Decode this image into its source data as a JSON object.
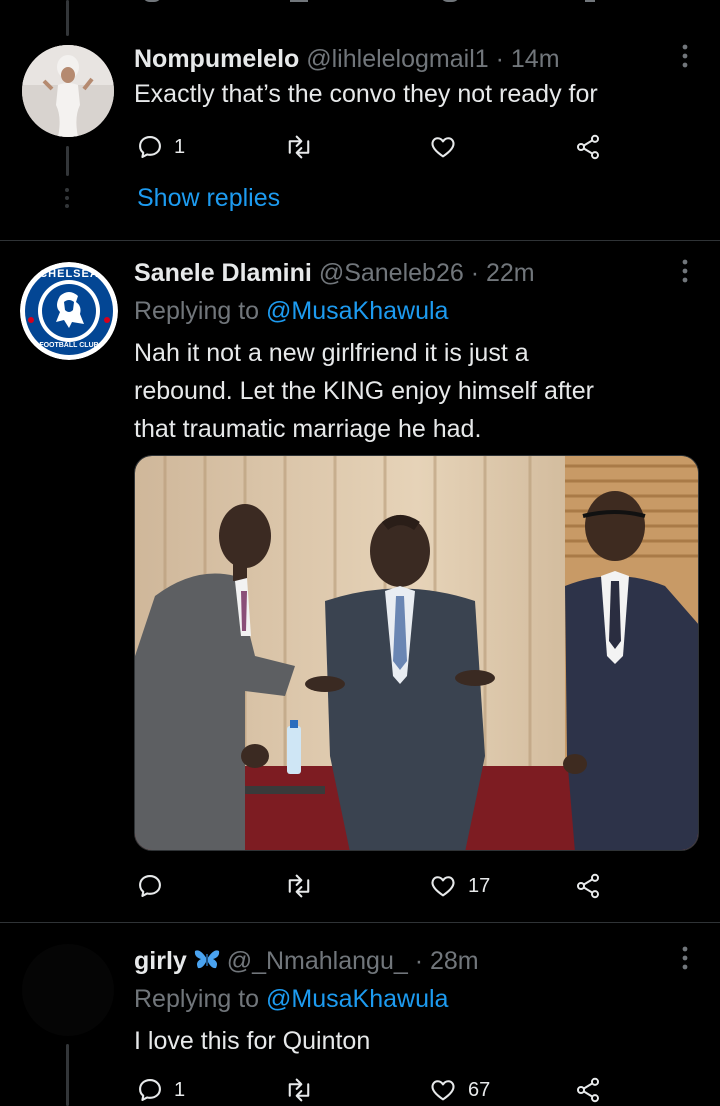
{
  "tweets": [
    {
      "display_name": "Nompumelelo",
      "handle": "@lihlelelogmail1",
      "separator": "·",
      "time": "14m",
      "body": "Exactly that’s the convo they not ready for",
      "actions": {
        "replies": "1",
        "retweets": "",
        "likes": ""
      },
      "show_replies": "Show replies"
    },
    {
      "display_name": "Sanele Dlamini",
      "handle": "@Saneleb26",
      "separator": "·",
      "time": "22m",
      "replying_prefix": "Replying to",
      "replying_to": "@MusaKhawula",
      "body_lines": [
        "Nah it not a new girlfriend it is just a",
        "rebound. Let the KING enjoy himself after",
        "that traumatic marriage he had."
      ],
      "avatar_badge": {
        "top_text": "CHELSEA",
        "bottom_text": "FOOTBALL CLUB"
      },
      "actions": {
        "replies": "",
        "retweets": "",
        "likes": "17"
      }
    },
    {
      "display_name": "girly",
      "handle": "@_Nmahlangu_",
      "separator": "·",
      "time": "28m",
      "replying_prefix": "Replying to",
      "replying_to": "@MusaKhawula",
      "body": "I love this for Quinton",
      "actions": {
        "replies": "1",
        "retweets": "",
        "likes": "67"
      }
    }
  ],
  "icons": [
    "reply-icon",
    "retweet-icon",
    "like-icon",
    "share-icon",
    "more-icon",
    "butterfly-emoji-icon"
  ],
  "colors": {
    "background": "#000000",
    "text": "#e7e9ea",
    "muted": "#71767b",
    "link": "#1d9bf0",
    "divider": "#2f3336",
    "chelsea_blue": "#034694"
  }
}
